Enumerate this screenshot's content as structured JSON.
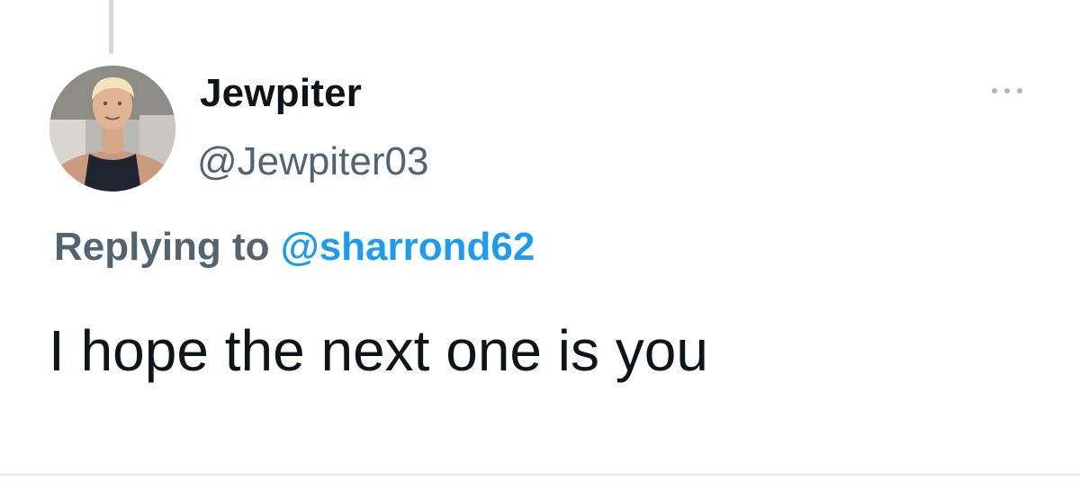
{
  "author": {
    "display_name": "Jewpiter",
    "handle": "@Jewpiter03",
    "avatar_icon": "profile-photo"
  },
  "reply": {
    "prefix": "Replying to",
    "mention": "@sharrond62"
  },
  "tweet": {
    "text": "I hope the next one is you"
  },
  "actions": {
    "more_icon": "more-horizontal-icon"
  },
  "colors": {
    "primary_text": "#0f1419",
    "secondary_text": "#536471",
    "mention": "#1d9bf0",
    "thread_line": "#cfd9de",
    "background": "#ffffff"
  }
}
